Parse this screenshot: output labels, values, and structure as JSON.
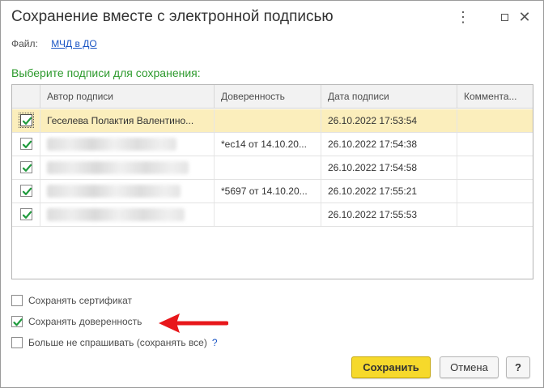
{
  "dialog": {
    "title": "Сохранение вместе с электронной подписью",
    "controls": {
      "more_icon": "more-dots-icon",
      "maximize_icon": "maximize-icon",
      "close_icon": "close-icon"
    }
  },
  "file": {
    "label": "Файл:",
    "link": "МЧД в ДО"
  },
  "section_title": "Выберите подписи для сохранения:",
  "table": {
    "columns": [
      "Автор подписи",
      "Доверенность",
      "Дата подписи",
      "Коммента..."
    ],
    "rows": [
      {
        "checked": true,
        "author": "Геселева Полактия Валентино...",
        "author_redacted": false,
        "power_of_attorney": "",
        "date": "26.10.2022 17:53:54",
        "comment": "",
        "selected": true
      },
      {
        "checked": true,
        "author": "",
        "author_redacted": true,
        "power_of_attorney": "*ес14 от 14.10.20...",
        "date": "26.10.2022 17:54:38",
        "comment": "",
        "selected": false
      },
      {
        "checked": true,
        "author": "",
        "author_redacted": true,
        "power_of_attorney": "",
        "date": "26.10.2022 17:54:58",
        "comment": "",
        "selected": false
      },
      {
        "checked": true,
        "author": "",
        "author_redacted": true,
        "power_of_attorney": "*5697 от 14.10.20...",
        "date": "26.10.2022 17:55:21",
        "comment": "",
        "selected": false
      },
      {
        "checked": true,
        "author": "",
        "author_redacted": true,
        "power_of_attorney": "",
        "date": "26.10.2022 17:55:53",
        "comment": "",
        "selected": false
      }
    ]
  },
  "options": {
    "save_certificate": {
      "label": "Сохранять сертификат",
      "checked": false
    },
    "save_power_of_attorney": {
      "label": "Сохранять доверенность",
      "checked": true
    },
    "dont_ask": {
      "label": "Больше не спрашивать (сохранять все)",
      "checked": false,
      "help": "?"
    }
  },
  "annotation": {
    "arrow_color": "#e8171b",
    "points_to": "save_power_of_attorney"
  },
  "buttons": {
    "save": "Сохранить",
    "cancel": "Отмена",
    "help": "?"
  },
  "colors": {
    "accent_green": "#2d9a2d",
    "link_blue": "#1a55c4",
    "save_button": "#f6d92b",
    "selected_row": "#fbeebc",
    "check_green": "#1e9a3c"
  }
}
